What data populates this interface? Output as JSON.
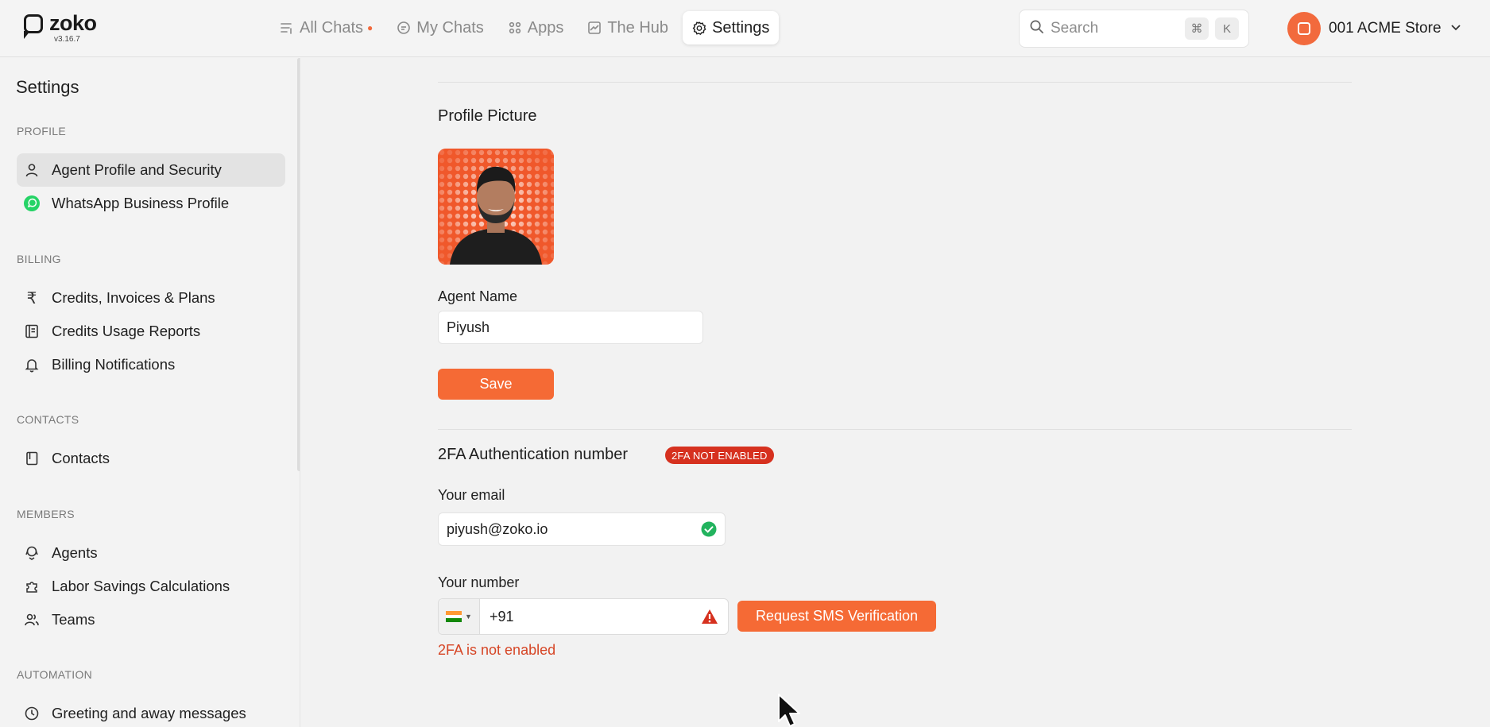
{
  "header": {
    "logo_text": "zoko",
    "version": "v3.16.7",
    "nav": [
      {
        "label": "All Chats",
        "icon": "list-filter-icon",
        "has_dot": true
      },
      {
        "label": "My Chats",
        "icon": "chat-bubble-icon"
      },
      {
        "label": "Apps",
        "icon": "apps-grid-icon"
      },
      {
        "label": "The Hub",
        "icon": "chart-line-icon"
      },
      {
        "label": "Settings",
        "icon": "gear-icon",
        "active": true
      }
    ],
    "search": {
      "placeholder": "Search",
      "shortcut_keys": [
        "⌘",
        "K"
      ]
    },
    "store": {
      "name": "001 ACME Store"
    }
  },
  "sidebar": {
    "title": "Settings",
    "sections": [
      {
        "label": "PROFILE",
        "items": [
          {
            "label": "Agent Profile and Security",
            "icon": "user-icon",
            "active": true
          },
          {
            "label": "WhatsApp Business Profile",
            "icon": "whatsapp-icon"
          }
        ]
      },
      {
        "label": "BILLING",
        "items": [
          {
            "label": "Credits, Invoices & Plans",
            "icon": "rupee-icon"
          },
          {
            "label": "Credits Usage Reports",
            "icon": "report-icon"
          },
          {
            "label": "Billing Notifications",
            "icon": "bell-icon"
          }
        ]
      },
      {
        "label": "CONTACTS",
        "items": [
          {
            "label": "Contacts",
            "icon": "address-book-icon"
          }
        ]
      },
      {
        "label": "MEMBERS",
        "items": [
          {
            "label": "Agents",
            "icon": "agent-icon"
          },
          {
            "label": "Labor Savings Calculations",
            "icon": "puzzle-icon"
          },
          {
            "label": "Teams",
            "icon": "users-icon"
          }
        ]
      },
      {
        "label": "AUTOMATION",
        "items": [
          {
            "label": "Greeting and away messages",
            "icon": "clock-icon"
          }
        ]
      }
    ]
  },
  "main": {
    "profile_picture_title": "Profile Picture",
    "agent_name_label": "Agent Name",
    "agent_name_value": "Piyush",
    "save_label": "Save",
    "twofa_title": "2FA Authentication number",
    "twofa_badge": "2FA NOT ENABLED",
    "email_label": "Your email",
    "email_value": "piyush@zoko.io",
    "number_label": "Your number",
    "number_value": "+91",
    "request_sms_label": "Request SMS Verification",
    "error_text": "2FA is not enabled"
  },
  "colors": {
    "accent": "#f56a35",
    "badge_red": "#d6311f",
    "error_text": "#d64525",
    "success_green": "#22b35e",
    "warning_red": "#d6311f"
  }
}
